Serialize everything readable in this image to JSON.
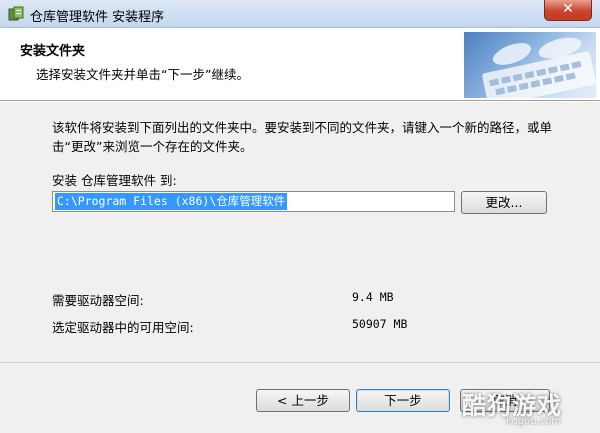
{
  "window": {
    "title": "仓库管理软件 安装程序",
    "close_label": "✕",
    "app_icon": "installer-icon"
  },
  "header": {
    "title": "安装文件夹",
    "subtitle": "选择安装文件夹并单击“下一步”继续。",
    "banner_image": "keyboard-typing-banner"
  },
  "main": {
    "intro": "该软件将安装到下面列出的文件夹中。要安装到不同的文件夹，请键入一个新的路径，或单击“更改”来浏览一个存在的文件夹。",
    "install_label": "安装 仓库管理软件 到:",
    "install_path": "C:\\Program Files (x86)\\仓库管理软件",
    "change_button": "更改...",
    "required_space_label": "需要驱动器空间:",
    "required_space_value": "9.4 MB",
    "available_space_label": "选定驱动器中的可用空间:",
    "available_space_value": "50907 MB"
  },
  "footer": {
    "back_button": "< 上一步",
    "next_button": "下一步",
    "cancel_button": "取消"
  },
  "watermark": {
    "text": "酷狗游戏",
    "url": "kugou.com"
  },
  "colors": {
    "selection": "#3399ff",
    "close": "#c9452d",
    "titlebar": "#c5d7ee"
  }
}
